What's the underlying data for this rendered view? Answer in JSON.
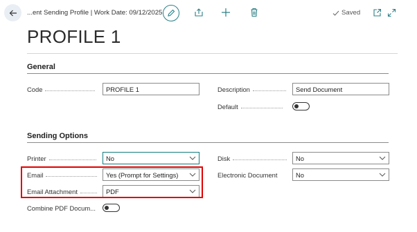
{
  "header": {
    "breadcrumb": "...ent Sending Profile | Work Date: 09/12/2025",
    "saved_label": "Saved"
  },
  "page": {
    "title": "PROFILE 1"
  },
  "general": {
    "section_title": "General",
    "code_label": "Code",
    "code_value": "PROFILE 1",
    "description_label": "Description",
    "description_value": "Send Document",
    "default_label": "Default",
    "default_on": false
  },
  "sending_options": {
    "section_title": "Sending Options",
    "printer_label": "Printer",
    "printer_value": "No",
    "email_label": "Email",
    "email_value": "Yes (Prompt for Settings)",
    "email_attachment_label": "Email Attachment",
    "email_attachment_value": "PDF",
    "combine_pdf_label": "Combine PDF Docum...",
    "combine_pdf_on": false,
    "disk_label": "Disk",
    "disk_value": "No",
    "electronic_document_label": "Electronic Document",
    "electronic_document_value": "No"
  },
  "colors": {
    "accent": "#0f7b80",
    "highlight": "#e00000"
  }
}
